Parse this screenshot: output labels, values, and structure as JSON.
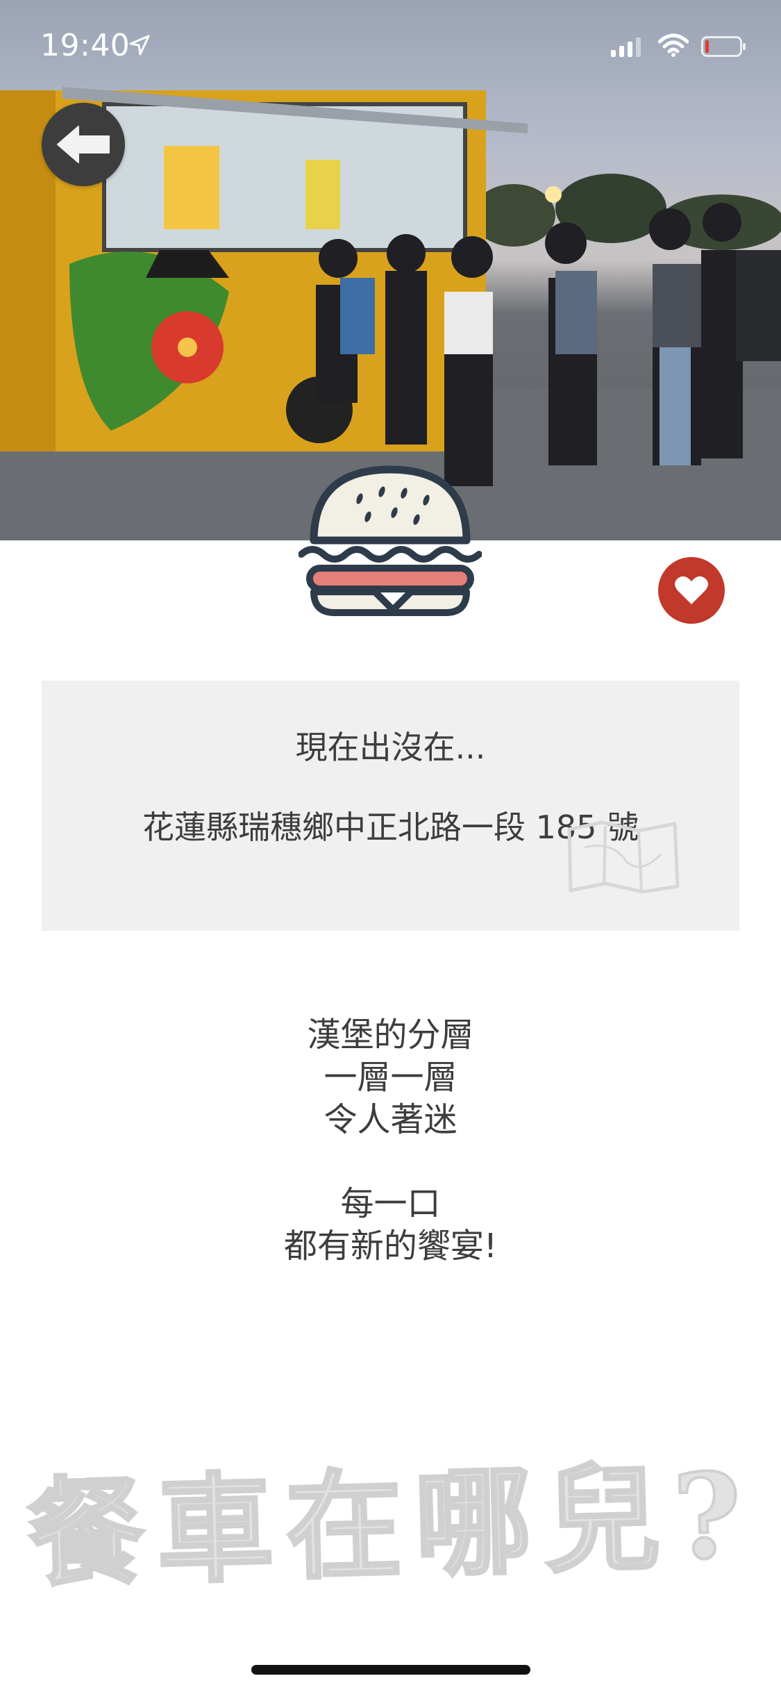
{
  "status_bar": {
    "time": "19:40"
  },
  "icons": {
    "back": "arrow-left-icon",
    "favorite": "heart-icon",
    "logo": "burger-icon",
    "map": "map-icon",
    "location": "location-arrow-icon",
    "signal": "cellular-signal-icon",
    "wifi": "wifi-icon",
    "battery": "battery-low-icon"
  },
  "location": {
    "heading": "現在出沒在...",
    "address": "花蓮縣瑞穗鄉中正北路一段 185 號"
  },
  "slogan": {
    "line1": "漢堡的分層",
    "line2": "一層一層",
    "line3": "令人著迷",
    "line4": "每一口",
    "line5": "都有新的饗宴!"
  },
  "brand": {
    "title": "餐車在哪兒?"
  },
  "colors": {
    "accent_red": "#c0392b",
    "card_bg": "#f0f0f0",
    "text": "#3d3d3d",
    "burger_pink": "#e57f7a",
    "burger_outline": "#2e3b4a"
  }
}
